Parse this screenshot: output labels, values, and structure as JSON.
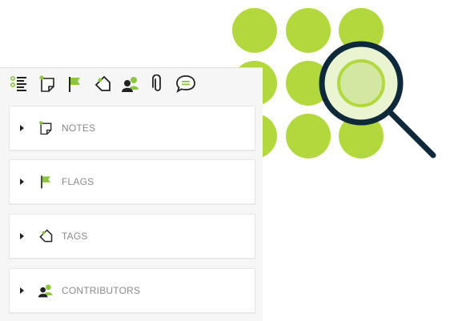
{
  "toolbar": {
    "icons": [
      {
        "name": "outline-list-icon"
      },
      {
        "name": "note-icon"
      },
      {
        "name": "flag-icon"
      },
      {
        "name": "tag-icon"
      },
      {
        "name": "contributors-icon"
      },
      {
        "name": "attachment-icon"
      },
      {
        "name": "comment-icon"
      }
    ]
  },
  "sections": [
    {
      "label": "NOTES",
      "icon": "note-icon"
    },
    {
      "label": "FLAGS",
      "icon": "flag-icon"
    },
    {
      "label": "TAGS",
      "icon": "tag-icon"
    },
    {
      "label": "CONTRIBUTORS",
      "icon": "contributors-icon"
    }
  ],
  "colors": {
    "accent_green": "#b3d83d",
    "light_green": "#8cc63f",
    "magnifier_dark": "#0e2a3a",
    "text_gray": "#8a8a8a"
  }
}
